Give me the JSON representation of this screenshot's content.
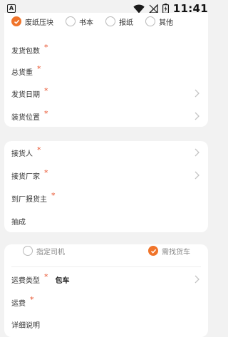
{
  "status_bar": {
    "app_badge": "A",
    "time": "11:41"
  },
  "cargo_types": [
    {
      "label": "废纸压块",
      "checked": true
    },
    {
      "label": "书本",
      "checked": false
    },
    {
      "label": "报纸",
      "checked": false
    },
    {
      "label": "其他",
      "checked": false
    }
  ],
  "shipment": {
    "packages_label": "发货包数",
    "weight_label": "总货重",
    "date_label": "发货日期",
    "location_label": "装货位置",
    "required_mark": "*"
  },
  "receiver": {
    "receiver_label": "接货人",
    "factory_label": "接货厂家",
    "shipper_label": "到厂报货主",
    "commission_label": "抽成"
  },
  "transport": {
    "option_driver": "指定司机",
    "option_truck": "需找货车",
    "freight_type_label": "运费类型",
    "freight_type_value": "包车",
    "freight_label": "运费",
    "details_label": "详细说明"
  },
  "colors": {
    "accent": "#f0742a",
    "required": "#e8502a",
    "background": "#f2f2f2",
    "card": "#ffffff"
  }
}
